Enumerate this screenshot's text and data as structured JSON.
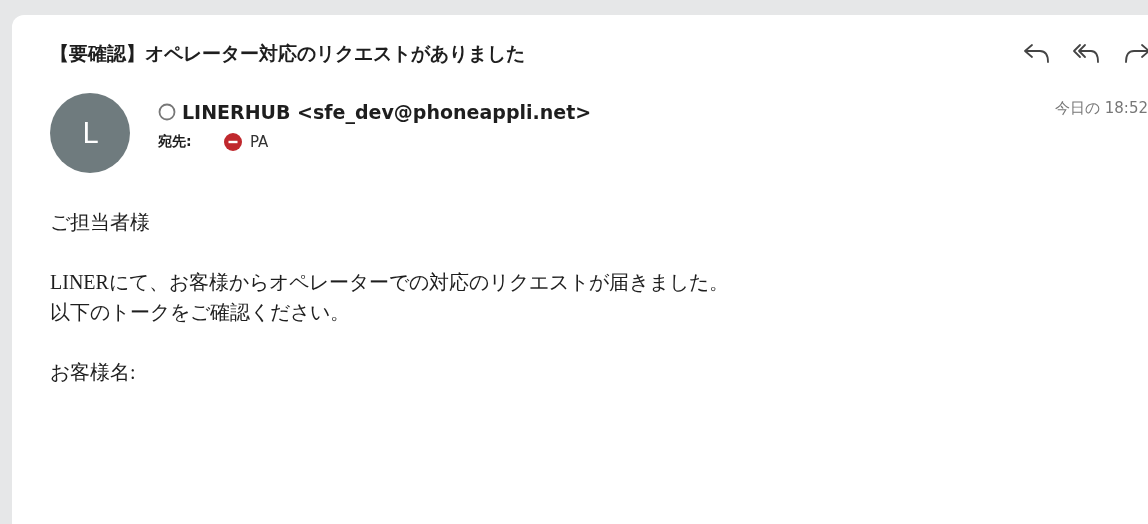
{
  "subject": "【要確認】オペレーター対応のリクエストがありました",
  "sender": {
    "avatar_letter": "L",
    "name": "LINERHUB <sfe_dev@phoneappli.net>"
  },
  "recipient": {
    "label": "宛先:",
    "name": "PA"
  },
  "time": "今日の 18:52",
  "body": [
    {
      "lines": [
        "ご担当者様"
      ]
    },
    {
      "lines": [
        "LINERにて、お客様からオペレーターでの対応のリクエストが届きました。",
        "以下のトークをご確認ください。"
      ]
    },
    {
      "lines": [
        "お客様名:"
      ]
    }
  ]
}
